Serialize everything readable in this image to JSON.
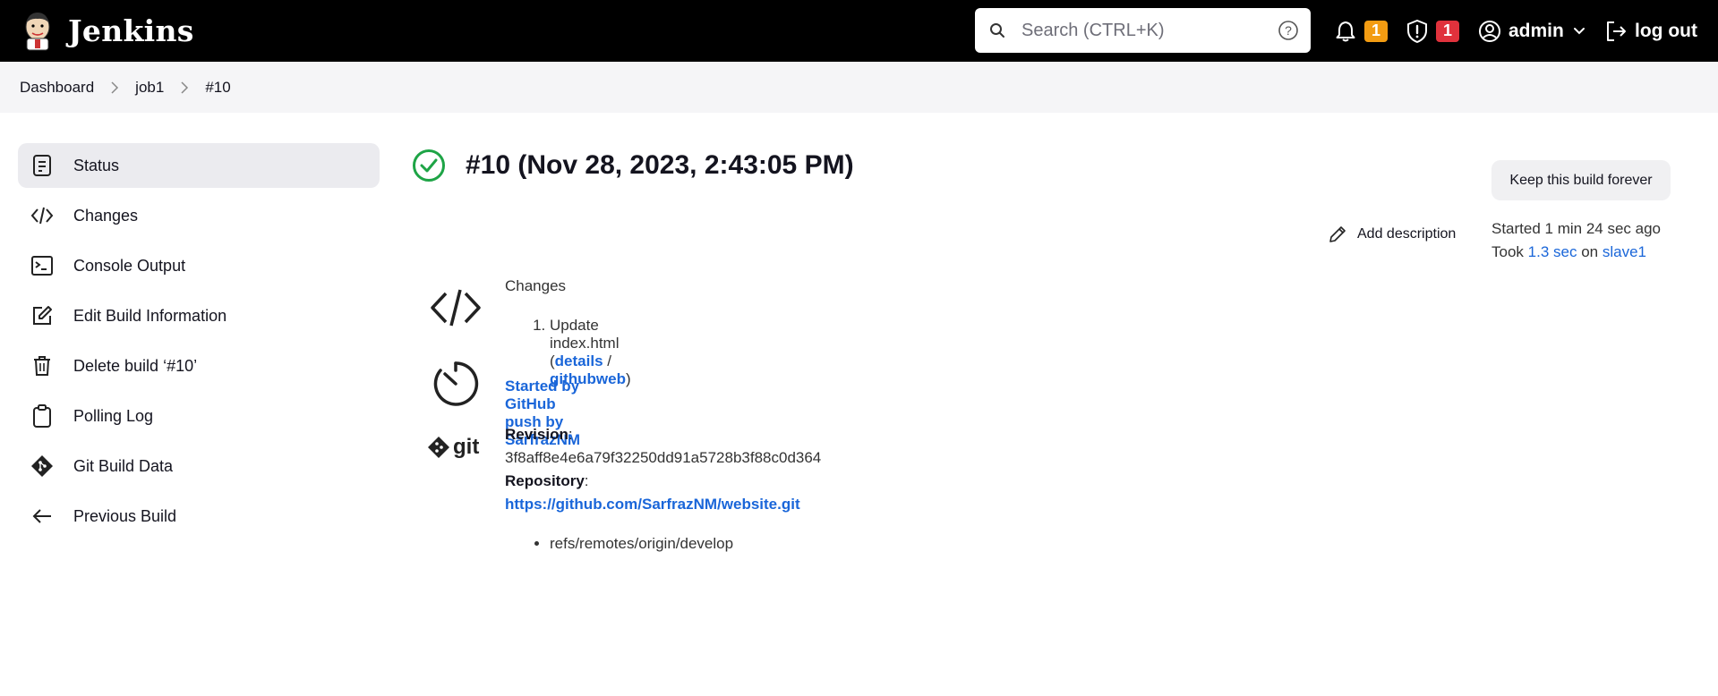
{
  "app": {
    "name": "Jenkins"
  },
  "search": {
    "placeholder": "Search (CTRL+K)"
  },
  "header": {
    "notifications_count": "1",
    "security_count": "1",
    "user": "admin",
    "logout_label": "log out"
  },
  "breadcrumb": [
    "Dashboard",
    "job1",
    "#10"
  ],
  "sidebar": {
    "items": [
      {
        "label": "Status",
        "icon": "status-icon",
        "active": true
      },
      {
        "label": "Changes",
        "icon": "code-icon"
      },
      {
        "label": "Console Output",
        "icon": "terminal-icon"
      },
      {
        "label": "Edit Build Information",
        "icon": "edit-icon"
      },
      {
        "label": "Delete build ‘#10’",
        "icon": "trash-icon"
      },
      {
        "label": "Polling Log",
        "icon": "clipboard-icon"
      },
      {
        "label": "Git Build Data",
        "icon": "git-icon"
      },
      {
        "label": "Previous Build",
        "icon": "arrow-left-icon"
      }
    ]
  },
  "build": {
    "title": "#10 (Nov 28, 2023, 2:43:05 PM)",
    "keep_label": "Keep this build forever",
    "add_description_label": "Add description",
    "started": "Started 1 min 24 sec ago",
    "took_prefix": "Took",
    "duration": "1.3 sec",
    "on_label": "on",
    "agent": "slave1"
  },
  "changes": {
    "heading": "Changes",
    "items": [
      {
        "text": "Update index.html",
        "details": "details",
        "githubweb": "githubweb"
      }
    ]
  },
  "cause": {
    "text": "Started by GitHub push by SarfrazNM"
  },
  "git": {
    "revision_label": "Revision",
    "revision": "3f8aff8e4e6a79f32250dd91a5728b3f88c0d364",
    "repository_label": "Repository",
    "repository_url": "https://github.com/SarfrazNM/website.git",
    "refs": [
      "refs/remotes/origin/develop"
    ]
  },
  "colors": {
    "header_bg": "#000000",
    "accent_link": "#1a66d9",
    "success_green": "#1ea446",
    "badge_orange": "#f39c12",
    "badge_red": "#e0323c"
  }
}
